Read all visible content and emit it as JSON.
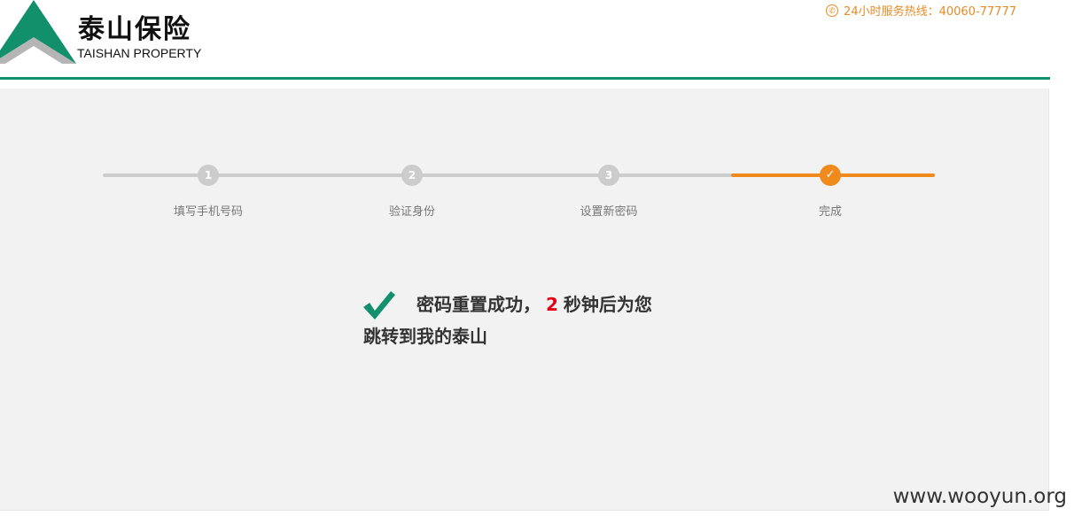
{
  "header": {
    "logo_cn": "泰山保险",
    "logo_en": "TAISHAN PROPERTY",
    "hotline_text": "24小时服务热线：40060-77777"
  },
  "steps": [
    {
      "number": "1",
      "label": "填写手机号码"
    },
    {
      "number": "2",
      "label": "验证身份"
    },
    {
      "number": "3",
      "label": "设置新密码"
    },
    {
      "number": "✓",
      "label": "完成"
    }
  ],
  "message": {
    "part1": "密码重置成功，",
    "countdown": "2",
    "part2": "秒钟后为您",
    "part3": "跳转到我的泰山"
  },
  "watermark": "www.wooyun.org",
  "colors": {
    "brand_green": "#11906b",
    "accent_orange": "#f08a1c",
    "step_gray": "#cccccc",
    "countdown_red": "#e60012"
  }
}
